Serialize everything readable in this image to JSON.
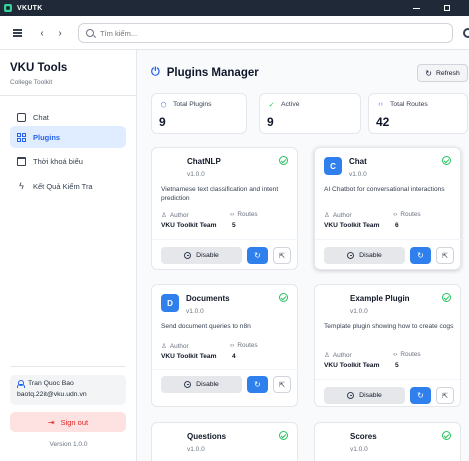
{
  "window": {
    "title": "VKUTK"
  },
  "toolbar": {
    "search_placeholder": "Tìm kiếm..."
  },
  "sidebar": {
    "brand": "VKU Tools",
    "subtitle": "College Toolkit",
    "items": [
      {
        "label": "Chat",
        "icon": "chat-icon"
      },
      {
        "label": "Plugins",
        "icon": "grid-icon",
        "active": true
      },
      {
        "label": "Thời khoá biểu",
        "icon": "calendar-icon"
      },
      {
        "label": "Kết Quả Kiểm Tra",
        "icon": "bolt-icon"
      }
    ],
    "user": {
      "name": "Tran Quoc Bao",
      "email": "baotq.22it@vku.udn.vn"
    },
    "signout_label": "Sign out",
    "version": "Version 1.0.0"
  },
  "main": {
    "title": "Plugins Manager",
    "refresh_label": "Refresh",
    "stats": [
      {
        "label": "Total Plugins",
        "value": "9",
        "icon": "cube-icon",
        "color": "#2563eb"
      },
      {
        "label": "Active",
        "value": "9",
        "icon": "check-circle-icon",
        "color": "#22c55e"
      },
      {
        "label": "Total Routes",
        "value": "42",
        "icon": "code-icon",
        "color": "#a855f7"
      }
    ],
    "author_label": "Author",
    "routes_label": "Routes",
    "disable_label": "Disable",
    "plugins": [
      {
        "name": "ChatNLP",
        "version": "v1.0.0",
        "desc": "Vietnamese text classification and intent prediction",
        "author": "VKU Toolkit Team",
        "routes": "5",
        "badge": ""
      },
      {
        "name": "Chat",
        "version": "v1.0.0",
        "desc": "AI Chatbot for conversational interactions",
        "author": "VKU Toolkit Team",
        "routes": "6",
        "badge": "C"
      },
      {
        "name": "Documents",
        "version": "v1.0.0",
        "desc": "Send document queries to n8n",
        "author": "VKU Toolkit Team",
        "routes": "4",
        "badge": "D"
      },
      {
        "name": "Example Plugin",
        "version": "v1.0.0",
        "desc": "Template plugin showing how to create cogs",
        "author": "VKU Toolkit Team",
        "routes": "5",
        "badge": ""
      },
      {
        "name": "Questions",
        "version": "v1.0.0",
        "desc": "",
        "author": "",
        "routes": "",
        "badge": ""
      },
      {
        "name": "Scores",
        "version": "v1.0.0",
        "desc": "",
        "author": "",
        "routes": "",
        "badge": ""
      }
    ]
  }
}
